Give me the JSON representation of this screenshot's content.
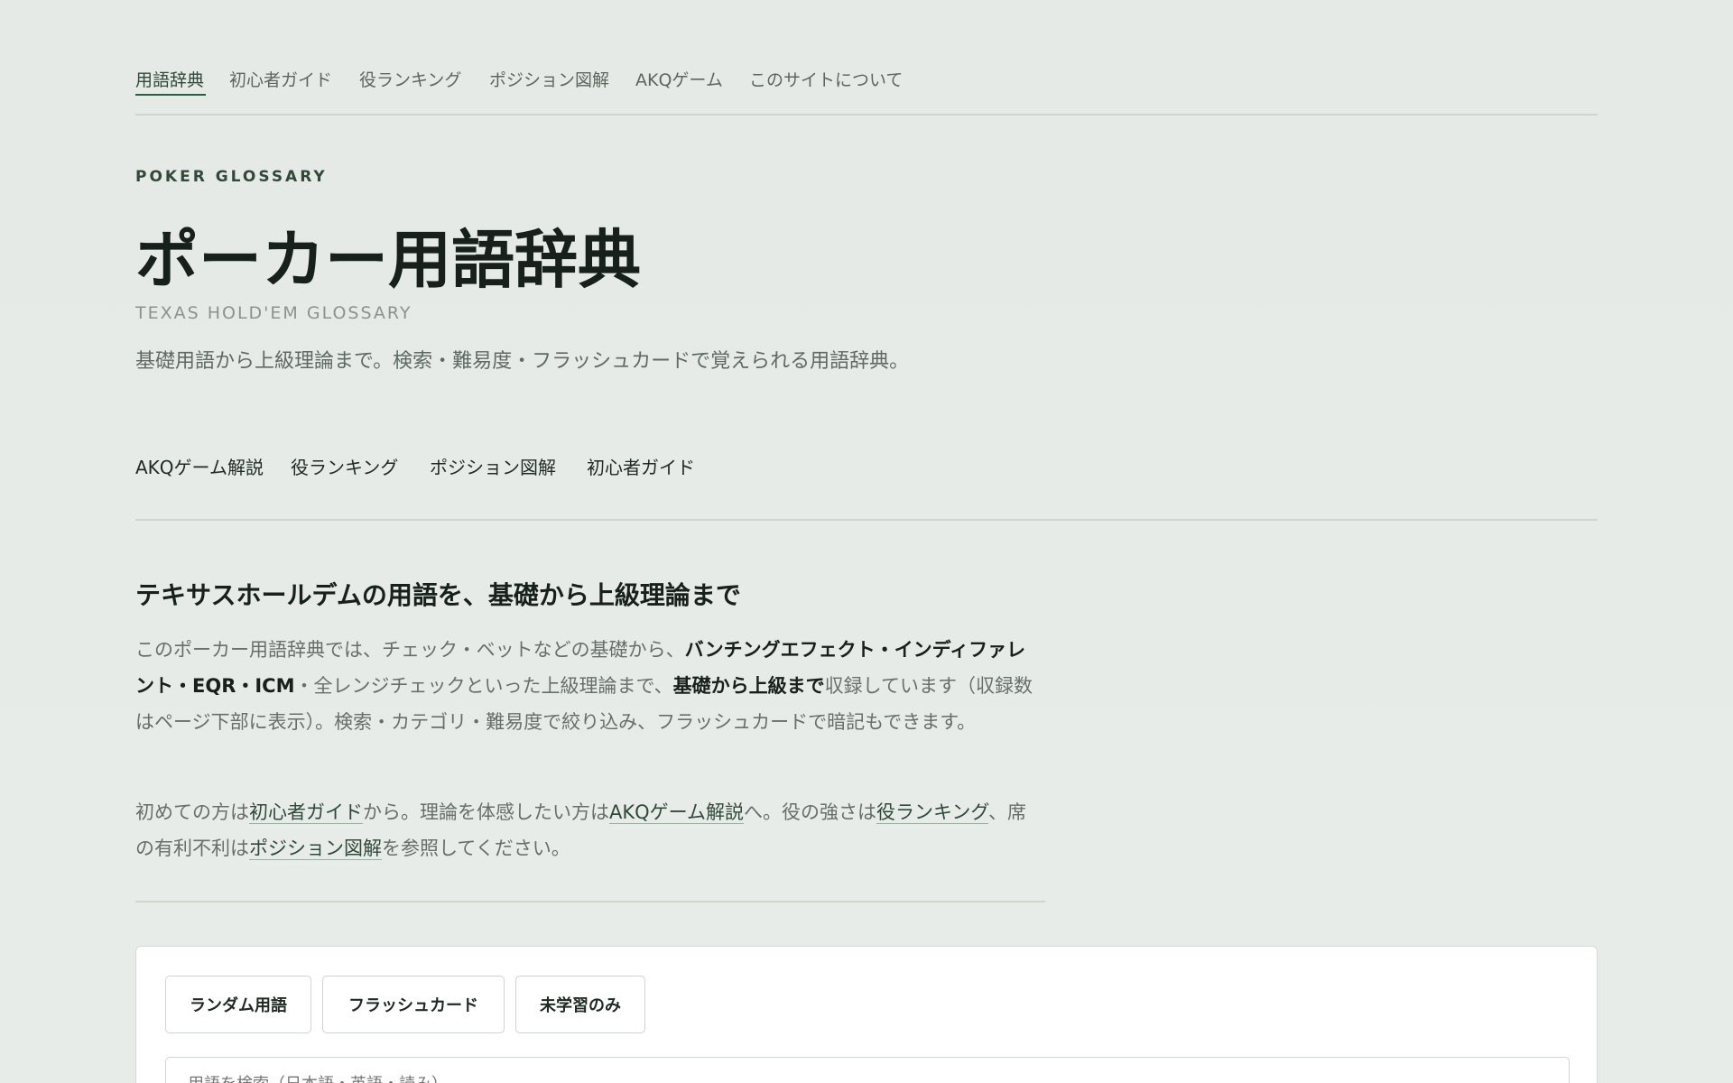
{
  "nav": {
    "items": [
      {
        "label": "用語辞典",
        "active": true
      },
      {
        "label": "初心者ガイド",
        "active": false
      },
      {
        "label": "役ランキング",
        "active": false
      },
      {
        "label": "ポジション図解",
        "active": false
      },
      {
        "label": "AKQゲーム",
        "active": false
      },
      {
        "label": "このサイトについて",
        "active": false
      }
    ]
  },
  "hero": {
    "eyebrow": "POKER GLOSSARY",
    "title": "ポーカー用語辞典",
    "subtitle": "TEXAS HOLD'EM GLOSSARY",
    "description": "基礎用語から上級理論まで。検索・難易度・フラッシュカードで覚えられる用語辞典。",
    "quick_links": [
      "AKQゲーム解説",
      "役ランキング",
      "ポジション図解",
      "初心者ガイド"
    ]
  },
  "intro": {
    "heading": "テキサスホールデムの用語を、基礎から上級理論まで",
    "p1": {
      "part1": "このポーカー用語辞典では、チェック・ベットなどの基礎から、",
      "bold1": "バンチングエフェクト・インディファレント・EQR・ICM",
      "part2": "・全レンジチェックといった上級理論まで、",
      "bold2": "基礎から上級まで",
      "part3": "収録しています（収録数はページ下部に表示）。検索・カテゴリ・難易度で絞り込み、フラッシュカードで暗記もできます。"
    },
    "p2": {
      "t1": "初めての方は",
      "link1": "初心者ガイド",
      "t2": "から。理論を体感したい方は",
      "link2": "AKQゲーム解説",
      "t3": "へ。役の強さは",
      "link3": "役ランキング",
      "t4": "、席の有利不利は",
      "link4": "ポジション図解",
      "t5": "を参照してください。"
    }
  },
  "tools": {
    "random_label": "ランダム用語",
    "flashcard_label": "フラッシュカード",
    "unlearned_label": "未学習のみ",
    "search_placeholder": "用語を検索（日本語・英語・読み）"
  }
}
